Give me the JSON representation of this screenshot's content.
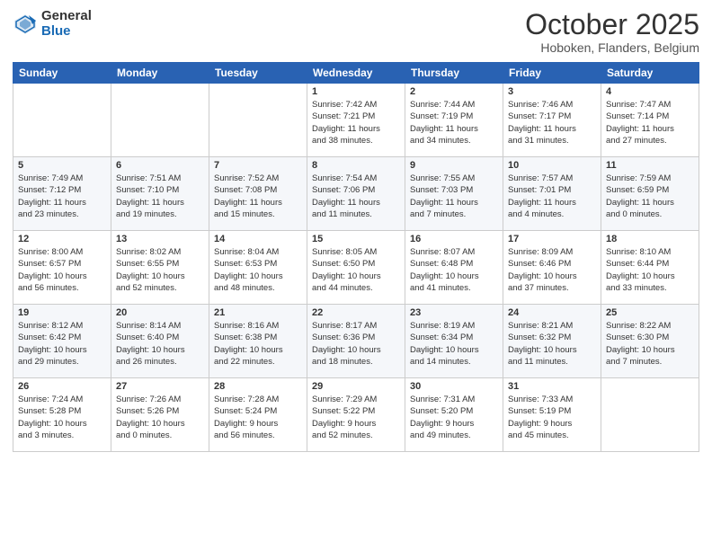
{
  "header": {
    "logo_general": "General",
    "logo_blue": "Blue",
    "month": "October 2025",
    "location": "Hoboken, Flanders, Belgium"
  },
  "weekdays": [
    "Sunday",
    "Monday",
    "Tuesday",
    "Wednesday",
    "Thursday",
    "Friday",
    "Saturday"
  ],
  "weeks": [
    [
      {
        "day": "",
        "info": ""
      },
      {
        "day": "",
        "info": ""
      },
      {
        "day": "",
        "info": ""
      },
      {
        "day": "1",
        "info": "Sunrise: 7:42 AM\nSunset: 7:21 PM\nDaylight: 11 hours\nand 38 minutes."
      },
      {
        "day": "2",
        "info": "Sunrise: 7:44 AM\nSunset: 7:19 PM\nDaylight: 11 hours\nand 34 minutes."
      },
      {
        "day": "3",
        "info": "Sunrise: 7:46 AM\nSunset: 7:17 PM\nDaylight: 11 hours\nand 31 minutes."
      },
      {
        "day": "4",
        "info": "Sunrise: 7:47 AM\nSunset: 7:14 PM\nDaylight: 11 hours\nand 27 minutes."
      }
    ],
    [
      {
        "day": "5",
        "info": "Sunrise: 7:49 AM\nSunset: 7:12 PM\nDaylight: 11 hours\nand 23 minutes."
      },
      {
        "day": "6",
        "info": "Sunrise: 7:51 AM\nSunset: 7:10 PM\nDaylight: 11 hours\nand 19 minutes."
      },
      {
        "day": "7",
        "info": "Sunrise: 7:52 AM\nSunset: 7:08 PM\nDaylight: 11 hours\nand 15 minutes."
      },
      {
        "day": "8",
        "info": "Sunrise: 7:54 AM\nSunset: 7:06 PM\nDaylight: 11 hours\nand 11 minutes."
      },
      {
        "day": "9",
        "info": "Sunrise: 7:55 AM\nSunset: 7:03 PM\nDaylight: 11 hours\nand 7 minutes."
      },
      {
        "day": "10",
        "info": "Sunrise: 7:57 AM\nSunset: 7:01 PM\nDaylight: 11 hours\nand 4 minutes."
      },
      {
        "day": "11",
        "info": "Sunrise: 7:59 AM\nSunset: 6:59 PM\nDaylight: 11 hours\nand 0 minutes."
      }
    ],
    [
      {
        "day": "12",
        "info": "Sunrise: 8:00 AM\nSunset: 6:57 PM\nDaylight: 10 hours\nand 56 minutes."
      },
      {
        "day": "13",
        "info": "Sunrise: 8:02 AM\nSunset: 6:55 PM\nDaylight: 10 hours\nand 52 minutes."
      },
      {
        "day": "14",
        "info": "Sunrise: 8:04 AM\nSunset: 6:53 PM\nDaylight: 10 hours\nand 48 minutes."
      },
      {
        "day": "15",
        "info": "Sunrise: 8:05 AM\nSunset: 6:50 PM\nDaylight: 10 hours\nand 44 minutes."
      },
      {
        "day": "16",
        "info": "Sunrise: 8:07 AM\nSunset: 6:48 PM\nDaylight: 10 hours\nand 41 minutes."
      },
      {
        "day": "17",
        "info": "Sunrise: 8:09 AM\nSunset: 6:46 PM\nDaylight: 10 hours\nand 37 minutes."
      },
      {
        "day": "18",
        "info": "Sunrise: 8:10 AM\nSunset: 6:44 PM\nDaylight: 10 hours\nand 33 minutes."
      }
    ],
    [
      {
        "day": "19",
        "info": "Sunrise: 8:12 AM\nSunset: 6:42 PM\nDaylight: 10 hours\nand 29 minutes."
      },
      {
        "day": "20",
        "info": "Sunrise: 8:14 AM\nSunset: 6:40 PM\nDaylight: 10 hours\nand 26 minutes."
      },
      {
        "day": "21",
        "info": "Sunrise: 8:16 AM\nSunset: 6:38 PM\nDaylight: 10 hours\nand 22 minutes."
      },
      {
        "day": "22",
        "info": "Sunrise: 8:17 AM\nSunset: 6:36 PM\nDaylight: 10 hours\nand 18 minutes."
      },
      {
        "day": "23",
        "info": "Sunrise: 8:19 AM\nSunset: 6:34 PM\nDaylight: 10 hours\nand 14 minutes."
      },
      {
        "day": "24",
        "info": "Sunrise: 8:21 AM\nSunset: 6:32 PM\nDaylight: 10 hours\nand 11 minutes."
      },
      {
        "day": "25",
        "info": "Sunrise: 8:22 AM\nSunset: 6:30 PM\nDaylight: 10 hours\nand 7 minutes."
      }
    ],
    [
      {
        "day": "26",
        "info": "Sunrise: 7:24 AM\nSunset: 5:28 PM\nDaylight: 10 hours\nand 3 minutes."
      },
      {
        "day": "27",
        "info": "Sunrise: 7:26 AM\nSunset: 5:26 PM\nDaylight: 10 hours\nand 0 minutes."
      },
      {
        "day": "28",
        "info": "Sunrise: 7:28 AM\nSunset: 5:24 PM\nDaylight: 9 hours\nand 56 minutes."
      },
      {
        "day": "29",
        "info": "Sunrise: 7:29 AM\nSunset: 5:22 PM\nDaylight: 9 hours\nand 52 minutes."
      },
      {
        "day": "30",
        "info": "Sunrise: 7:31 AM\nSunset: 5:20 PM\nDaylight: 9 hours\nand 49 minutes."
      },
      {
        "day": "31",
        "info": "Sunrise: 7:33 AM\nSunset: 5:19 PM\nDaylight: 9 hours\nand 45 minutes."
      },
      {
        "day": "",
        "info": ""
      }
    ]
  ]
}
